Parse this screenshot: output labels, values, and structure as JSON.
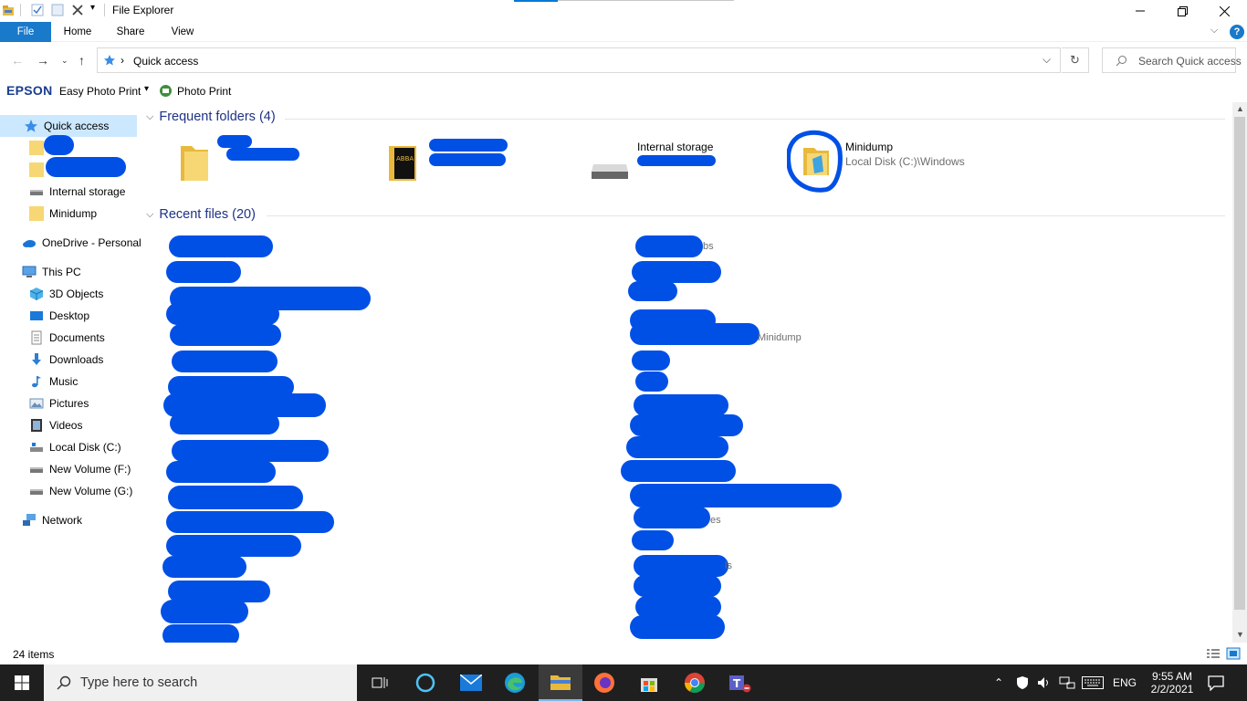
{
  "window": {
    "title": "File Explorer"
  },
  "ribbon": {
    "tabs": [
      {
        "label": "File"
      },
      {
        "label": "Home"
      },
      {
        "label": "Share"
      },
      {
        "label": "View"
      }
    ]
  },
  "address": {
    "path": "Quick access",
    "search_placeholder": "Search Quick access"
  },
  "epson_toolbar": {
    "brand": "EPSON",
    "easy_photo_print": "Easy Photo Print",
    "photo_print": "Photo Print"
  },
  "nav": {
    "quick_access": "Quick access",
    "internal_storage": "Internal storage",
    "minidump": "Minidump",
    "onedrive": "OneDrive - Personal",
    "this_pc": "This PC",
    "objects3d": "3D Objects",
    "desktop": "Desktop",
    "documents": "Documents",
    "downloads": "Downloads",
    "music": "Music",
    "pictures": "Pictures",
    "videos": "Videos",
    "local_disk": "Local Disk (C:)",
    "new_volume_f": "New Volume (F:)",
    "new_volume_g": "New Volume (G:)",
    "network": "Network"
  },
  "frequent": {
    "header": "Frequent folders (4)",
    "tiles": [
      {
        "name": "",
        "sub": ""
      },
      {
        "name": "",
        "sub": ""
      },
      {
        "name": "Internal storage",
        "sub": ""
      },
      {
        "name": "Minidump",
        "sub": "Local Disk (C:)\\Windows"
      }
    ]
  },
  "recent": {
    "header": "Recent files (20)",
    "visible_fragments": {
      "f1": "bs",
      "f2": "Minidump",
      "f3": "es",
      "f4": "ls"
    }
  },
  "status": {
    "item_count": "24 items"
  },
  "taskbar": {
    "search_placeholder": "Type here to search",
    "language": "ENG",
    "time": "9:55 AM",
    "date": "2/2/2021"
  },
  "colors": {
    "accent": "#0078d7",
    "file_tab": "#1979ca",
    "selection": "#cce8ff",
    "group_header": "#1e3287",
    "redaction": "#0050e6"
  }
}
